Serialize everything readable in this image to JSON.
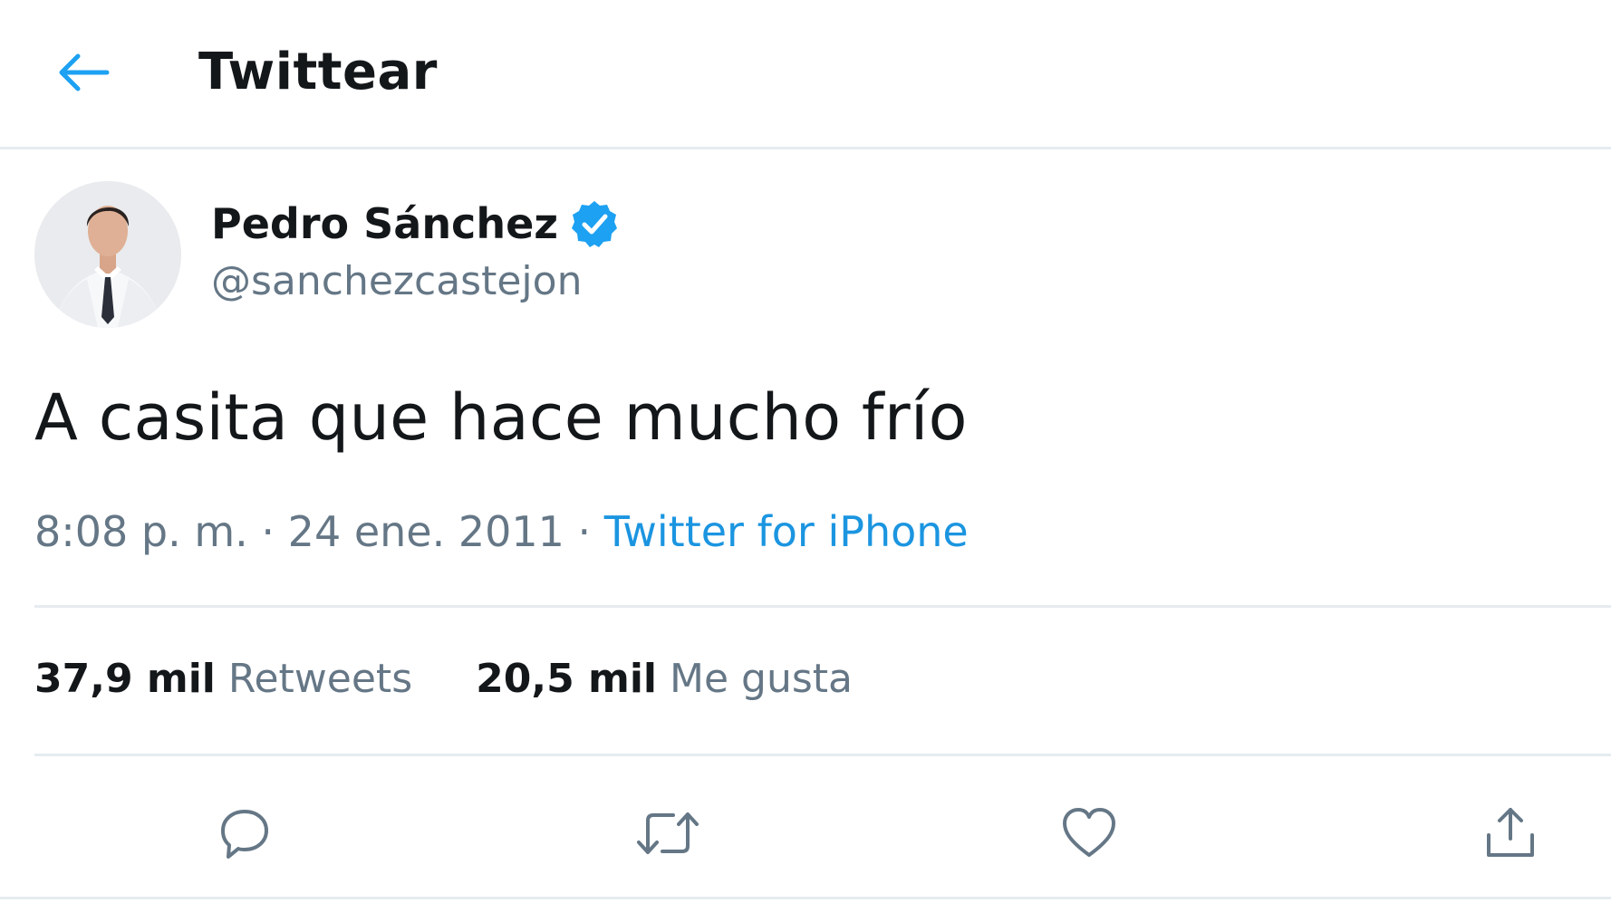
{
  "header": {
    "title": "Twittear",
    "back_icon": "arrow-left-icon"
  },
  "author": {
    "name": "Pedro Sánchez",
    "handle": "@sanchezcastejon",
    "verified_icon": "verified-badge-icon"
  },
  "tweet": {
    "text": "A casita que hace mucho frío",
    "time": "8:08 p. m.",
    "separator": "·",
    "date": "24 ene. 2011",
    "source": "Twitter for iPhone"
  },
  "stats": {
    "retweets_count": "37,9 mil",
    "retweets_label": "Retweets",
    "likes_count": "20,5 mil",
    "likes_label": "Me gusta"
  },
  "actions": [
    "reply-icon",
    "retweet-icon",
    "like-icon",
    "share-icon"
  ],
  "colors": {
    "accent": "#1da1f2",
    "link": "#1b95e0",
    "secondary_text": "#657786",
    "primary_text": "#14171a",
    "divider": "#e6ecf0"
  }
}
